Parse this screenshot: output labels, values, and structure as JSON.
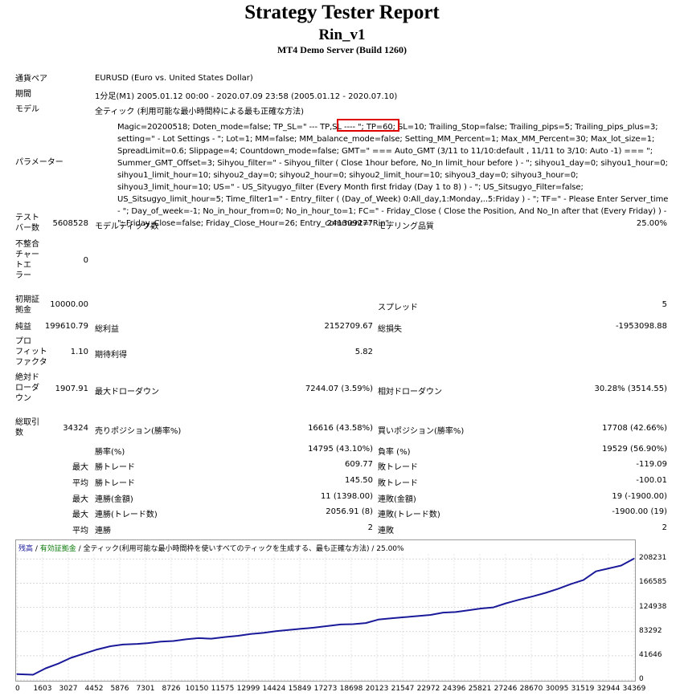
{
  "header": {
    "title": "Strategy Tester Report",
    "expert": "Rin_v1",
    "server": "MT4 Demo Server (Build 1260)"
  },
  "info": {
    "symbol_label": "通貨ペア",
    "symbol_value": "EURUSD (Euro vs. United States Dollar)",
    "period_label": "期間",
    "period_value": "1分足(M1) 2005.01.12 00:00 - 2020.07.09 23:58 (2005.01.12 - 2020.07.10)",
    "model_label": "モデル",
    "model_value": "全ティック (利用可能な最小時間枠による最も正確な方法)",
    "params_label": "パラメーター",
    "params_pre": "Magic=20200518; Doten_mode=false; TP_SL=\" --- TP,SL ---- \"; ",
    "params_tp": "TP=60; SL=10;",
    "params_post": " Trailing_Stop=false; Trailing_pips=5; Trailing_pips_plus=3; setting=\" - Lot Settings - \"; Lot=1; MM=false; MM_balance_mode=false; Setting_MM_Percent=1; Max_MM_Percent=30; Max_lot_size=1; SpreadLimit=0.6; Slippage=4; Countdown_mode=false; GMT=\" === Auto_GMT (3/11 to 11/10:default , 11/11 to 3/10: Auto -1) === \"; Summer_GMT_Offset=3; Sihyou_filter=\" - Sihyou_filter ( Close 1hour before, No_In limit_hour before ) - \"; sihyou1_day=0; sihyou1_hour=0; sihyou1_limit_hour=10; sihyou2_day=0; sihyou2_hour=0; sihyou2_limit_hour=10; sihyou3_day=0; sihyou3_hour=0; sihyou3_limit_hour=10; US=\" - US_Sityugyo_filter (Every Month first friday (Day 1 to 8) ) - \"; US_Sitsugyo_Filter=false; US_Sitsugyo_limit_hour=5; Time_filter1=\" - Entry_filter ( (Day_of_Week) 0:All_day,1:Monday,..5:Friday ) - \"; TF=\" - Please Enter Server_time - \"; Day_of_week=-1; No_in_hour_from=0; No_in_hour_to=1; FC=\" - Friday_Close ( Close the Position, And No_In after that (Every Friday) ) - \"; Friday_Close=false; Friday_Close_Hour=26; Entry_comment=\"Rin\";"
  },
  "stats": {
    "bars_label_a": "テスト",
    "bars_label_b": "バー数",
    "bars_value": "5608528",
    "ticks_label": "モデルティック数",
    "ticks_value": "241309277",
    "quality_label": "モデリング品質",
    "quality_value": "25.00%",
    "mismatch_label_a": "不整合",
    "mismatch_label_b": "チャー",
    "mismatch_label_c": "トエ",
    "mismatch_label_d": "ラー",
    "mismatch_value": "0",
    "deposit_label_a": "初期証",
    "deposit_label_b": "拠金",
    "deposit_value": "10000.00",
    "spread_label": "スプレッド",
    "spread_value": "5",
    "net_label": "純益",
    "net_value": "199610.79",
    "gross_profit_label": "総利益",
    "gross_profit_value": "2152709.67",
    "gross_loss_label": "総損失",
    "gross_loss_value": "-1953098.88",
    "pf_label_a": "プロ",
    "pf_label_b": "フィット",
    "pf_label_c": "ファクタ",
    "pf_value": "1.10",
    "payoff_label": "期待利得",
    "payoff_value": "5.82",
    "absdd_label_a": "絶対ド",
    "absdd_label_b": "ローダ",
    "absdd_label_c": "ウン",
    "absdd_value": "1907.91",
    "maxdd_label": "最大ドローダウン",
    "maxdd_value": "7244.07 (3.59%)",
    "reldd_label": "相対ドローダウン",
    "reldd_value": "30.28% (3514.55)",
    "trades_label_a": "総取引",
    "trades_label_b": "数",
    "trades_value": "34324",
    "short_label": "売りポジション(勝率%)",
    "short_value": "16616 (43.58%)",
    "long_label": "買いポジション(勝率%)",
    "long_value": "17708 (42.66%)",
    "win_label": "勝率(%)",
    "win_value": "14795 (43.10%)",
    "lose_label": "負率 (%)",
    "lose_value": "19529 (56.90%)",
    "largest_label": "最大",
    "lg_win_label": "勝トレード",
    "lg_win_value": "609.77",
    "lg_loss_label": "敗トレード",
    "lg_loss_value": "-119.09",
    "avg_label": "平均",
    "avg_win_label": "勝トレード",
    "avg_win_value": "145.50",
    "avg_loss_label": "敗トレード",
    "avg_loss_value": "-100.01",
    "max1_label": "最大",
    "cw_money_label": "連勝(金額)",
    "cw_money_value": "11 (1398.00)",
    "cl_money_label": "連敗(金額)",
    "cl_money_value": "19 (-1900.00)",
    "max2_label": "最大",
    "cw_count_label": "連勝(トレード数)",
    "cw_count_value": "2056.91 (8)",
    "cl_count_label": "連敗(トレード数)",
    "cl_count_value": "-1900.00 (19)",
    "avg2_label": "平均",
    "aw_label": "連勝",
    "aw_value": "2",
    "al_label": "連敗",
    "al_value": "2"
  },
  "chart_data": {
    "type": "line",
    "legend": [
      {
        "text": "残高",
        "color": "#1a1a9a"
      },
      {
        "text": " / ",
        "color": "#000000"
      },
      {
        "text": "有効証拠金",
        "color": "#0b7a0b"
      },
      {
        "text": " / 全ティック(利用可能な最小時間枠を使いすべてのティックを生成する、最も正確な方法) / 25.00%",
        "color": "#000000"
      }
    ],
    "yticks": [
      "208231",
      "166585",
      "124938",
      "83292",
      "41646",
      "0"
    ],
    "ytick_values": [
      208231,
      166585,
      124938,
      83292,
      41646,
      0
    ],
    "xticks": [
      "0",
      "1603",
      "3027",
      "4452",
      "5876",
      "7301",
      "8726",
      "10150",
      "11575",
      "12999",
      "14424",
      "15849",
      "17273",
      "18698",
      "20123",
      "21547",
      "22972",
      "24396",
      "25821",
      "27246",
      "28670",
      "30095",
      "31519",
      "32944",
      "34369"
    ],
    "ylim": [
      0,
      217000
    ],
    "xlim": [
      0,
      34324
    ],
    "grid": true,
    "line_color": "#1a1a9a",
    "series": [
      {
        "values_x": [
          0,
          900,
          1600,
          2300,
          3000,
          3700,
          4400,
          5200,
          5900,
          6700,
          7300,
          8000,
          8700,
          9400,
          10100,
          10800,
          11600,
          12300,
          13000,
          13700,
          14400,
          15100,
          15800,
          16500,
          17300,
          18000,
          18700,
          19400,
          20100,
          20800,
          21500,
          22300,
          23000,
          23700,
          24400,
          25100,
          25800,
          26500,
          27200,
          27900,
          28700,
          29400,
          30100,
          30800,
          31500,
          32200,
          32900,
          33600,
          34324
        ],
        "values_y": [
          10000,
          9000,
          20000,
          28000,
          38000,
          45000,
          52000,
          58000,
          61000,
          62000,
          63500,
          66000,
          67000,
          70000,
          72000,
          71000,
          74000,
          76000,
          79000,
          81000,
          84000,
          86000,
          88000,
          90000,
          93000,
          95500,
          96000,
          98000,
          104000,
          106000,
          108000,
          110000,
          112000,
          116000,
          117000,
          120000,
          123000,
          125000,
          132000,
          138000,
          144000,
          150000,
          157000,
          165000,
          172000,
          187000,
          192000,
          197000,
          209000
        ]
      }
    ]
  }
}
